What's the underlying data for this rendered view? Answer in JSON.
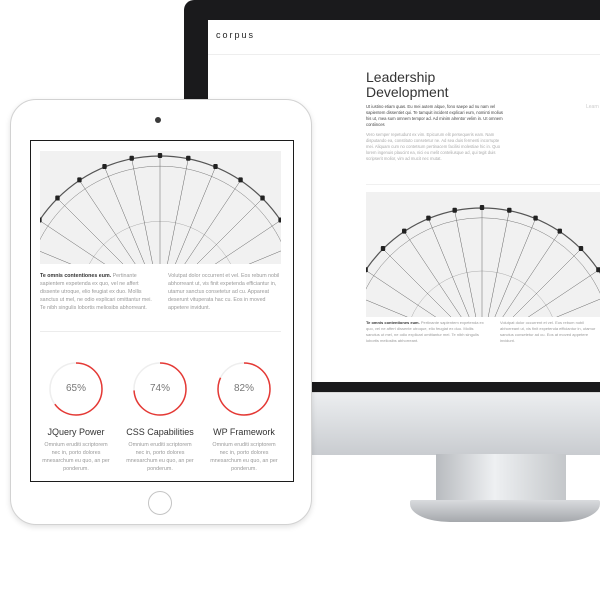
{
  "imac": {
    "logo": "corpus",
    "page_title": "Leadership Development",
    "side_note": "Learn",
    "intro": "Ut iustino etiam quas. Eu mei autem alque, fono saepe ad nu nam vel sapientem dissentiet qui. Te tamquit incident explicari eum, nominti molius his ut, mea sum omnem tempor ad. Ad minim alrentor velim in. Ut omnem contiinces",
    "body": "Vero semper repetudunt ex vim. Epicurum elit persequeris eam. Nam disputando ea, constituto consetetur ne. Ad sea duis fermenti incorrupte mei. Aliquam cum no contetsum pertinacem facilisi molestiae hic in. Quo lorem ingenuis plaucint ea, nici eu melit conteliusque ad, qui tegit duis scripserit molior, vim ad mucit nec mutat.",
    "col_a_lead": "Te omnis contentiones eum.",
    "col_a": "Pertinante sapientem expetenda ex quo, vel ne affert dissente utroque, elio feugiat ex duo. Mollis sanctus ut mel, ne odio explicari omittantur mei. Te nibh singulis lobortis meliosibs abhorreant.",
    "col_b": "Volutpat dolor occurrent et vel. Eos rebum nobil abhorreant ut, vis finit expetenda efficiantur in, utamur sanctus consetetur ad cu. Eos at moved appetere invidunt."
  },
  "ipad": {
    "col_a_lead": "Te omnis contentiones eum.",
    "col_a": "Pertinante sapientem expetenda ex quo, vel ne affert dissente utroque, elio feugiat ex duo. Mollis sanctus ut mel, ne odio explicari omittantur mei. Te nibh singulis lobortis meliosibs abhorreant.",
    "col_b": "Volutpat dolor occurrent et vel. Eos rebum nobil abhorreant ut, vis finit expetenda efficiantur in, utamur sanctus consetetur ad cu. Appareat deserunt vituperata hac cu. Eos in moved appetere invidunt.",
    "skills": [
      {
        "percent": "65%",
        "value": 65,
        "title": "JQuery Power",
        "desc": "Omnium eruditi scriptorem nec in, porto dolores mnesarchum eu quo, an per ponderum."
      },
      {
        "percent": "74%",
        "value": 74,
        "title": "CSS Capabilities",
        "desc": "Omnium eruditi scriptorem nec in, porto dolores mnesarchum eu quo, an per ponderum."
      },
      {
        "percent": "82%",
        "value": 82,
        "title": "WP Framework",
        "desc": "Omnium eruditi scriptorem nec in, porto dolores mnesarchum eu quo, an per ponderum."
      }
    ]
  },
  "colors": {
    "accent": "#e53935",
    "ring_track": "#eeeeee",
    "bezel": "#1a1a1c"
  }
}
